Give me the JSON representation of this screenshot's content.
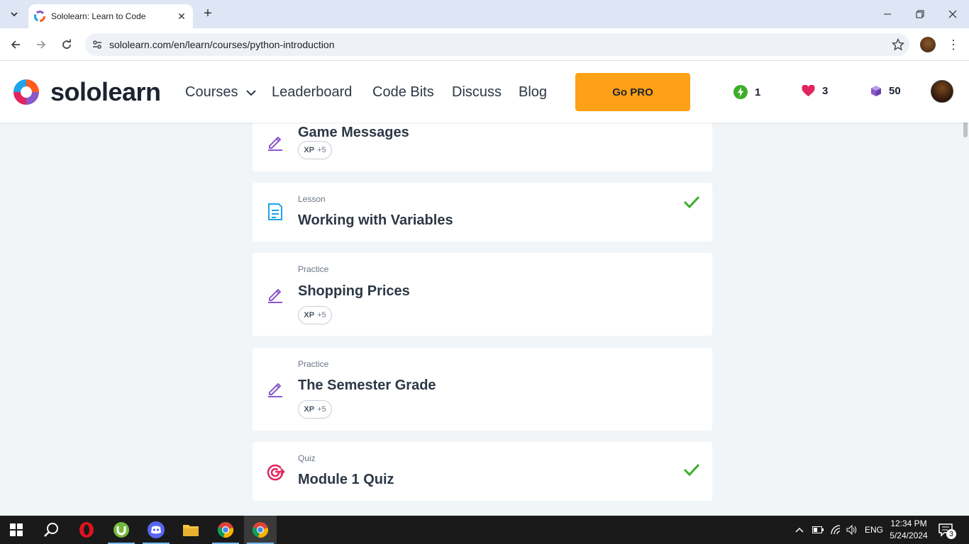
{
  "browser": {
    "tab_title": "Sololearn: Learn to Code",
    "url": "sololearn.com/en/learn/courses/python-introduction"
  },
  "site": {
    "brand": "sololearn",
    "nav": {
      "courses": "Courses",
      "leaderboard": "Leaderboard",
      "code_bits": "Code Bits",
      "discuss": "Discuss",
      "blog": "Blog"
    },
    "go_pro": "Go PRO",
    "stats": {
      "streak": "1",
      "hearts": "3",
      "gems": "50"
    }
  },
  "lessons": [
    {
      "kind": "",
      "name": "Game Messages",
      "xp_label": "XP",
      "xp_value": "+5",
      "completed": false,
      "icon": "pencil-icon"
    },
    {
      "kind": "Lesson",
      "name": "Working with Variables",
      "completed": true,
      "icon": "document-icon"
    },
    {
      "kind": "Practice",
      "name": "Shopping Prices",
      "xp_label": "XP",
      "xp_value": "+5",
      "completed": false,
      "icon": "pencil-icon"
    },
    {
      "kind": "Practice",
      "name": "The Semester Grade",
      "xp_label": "XP",
      "xp_value": "+5",
      "completed": false,
      "icon": "pencil-icon"
    },
    {
      "kind": "Quiz",
      "name": "Module 1 Quiz",
      "completed": true,
      "icon": "target-icon"
    }
  ],
  "colors": {
    "accent_pro": "#fea116",
    "practice_icon": "#8a58c9",
    "lesson_icon": "#1fa3e8",
    "quiz_icon": "#e0245e",
    "check": "#3dae2b"
  },
  "taskbar": {
    "language": "ENG",
    "time": "12:34 PM",
    "date": "5/24/2024",
    "notifications": "3"
  }
}
